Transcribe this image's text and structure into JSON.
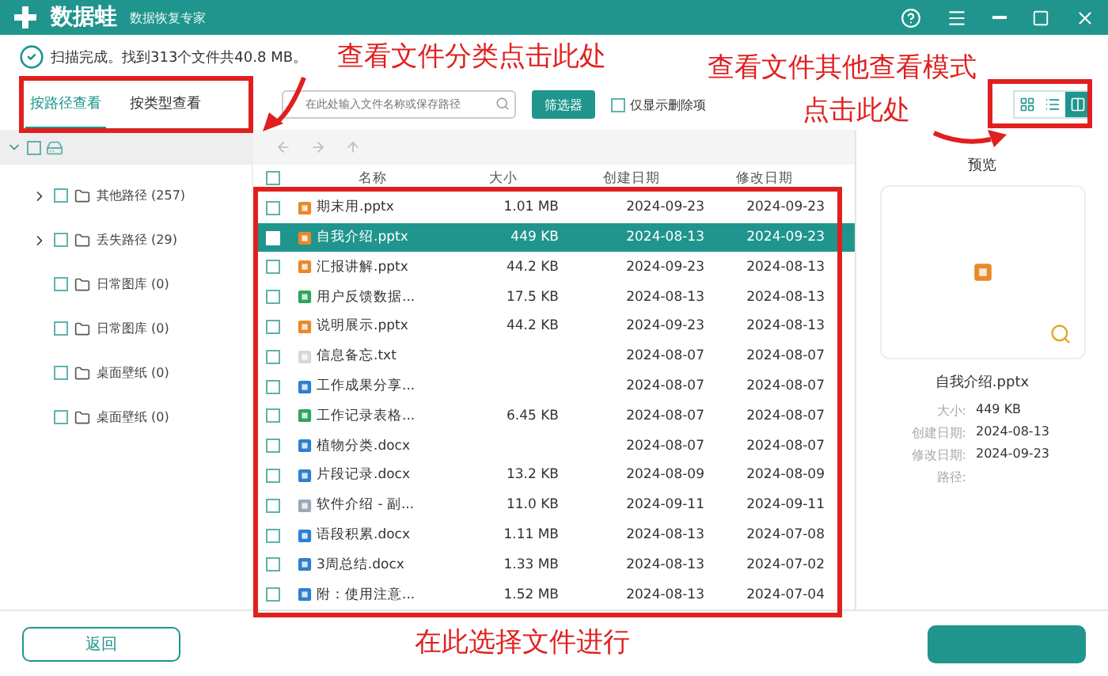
{
  "app": {
    "name": "数据蛙",
    "subtitle": "数据恢复专家"
  },
  "scan_status": "扫描完成。找到313个文件共40.8 MB。",
  "view_tabs": [
    {
      "label": "按路径查看",
      "selected": true
    },
    {
      "label": "按类型查看",
      "selected": false
    }
  ],
  "search": {
    "placeholder": "在此处输入文件名称或保存路径"
  },
  "filter_button": "筛选器",
  "deleted_only": {
    "label": "仅显示删除项",
    "checked": false
  },
  "view_modes": [
    {
      "kind": "grid",
      "selected": false
    },
    {
      "kind": "list",
      "selected": false
    },
    {
      "kind": "preview",
      "selected": true
    }
  ],
  "tree": {
    "expanded": true,
    "checked": false,
    "children": [
      {
        "label": "其他路径 (257)",
        "expandable": true,
        "checked": false
      },
      {
        "label": "丢失路径 (29)",
        "expandable": true,
        "checked": false
      },
      {
        "label": "日常图库 (0)",
        "expandable": false,
        "checked": false
      },
      {
        "label": "日常图库 (0)",
        "expandable": false,
        "checked": false
      },
      {
        "label": "桌面壁纸 (0)",
        "expandable": false,
        "checked": false
      },
      {
        "label": "桌面壁纸 (0)",
        "expandable": false,
        "checked": false
      }
    ]
  },
  "table": {
    "all_checked": false,
    "columns": [
      "名称",
      "大小",
      "创建日期",
      "修改日期"
    ],
    "rows": [
      {
        "kind": "ppt",
        "name": "期末用.pptx",
        "size": "1.01 MB",
        "created": "2024-09-23",
        "modified": "2024-09-23",
        "selected": false,
        "checked": false
      },
      {
        "kind": "ppt",
        "name": "自我介绍.pptx",
        "size": "449 KB",
        "created": "2024-08-13",
        "modified": "2024-09-23",
        "selected": true,
        "checked": false
      },
      {
        "kind": "ppt",
        "name": "汇报讲解.pptx",
        "size": "44.2 KB",
        "created": "2024-09-23",
        "modified": "2024-08-13",
        "selected": false,
        "checked": false
      },
      {
        "kind": "xls",
        "name": "用户反馈数据...",
        "size": "17.5 KB",
        "created": "2024-08-13",
        "modified": "2024-08-13",
        "selected": false,
        "checked": false
      },
      {
        "kind": "ppt",
        "name": "说明展示.pptx",
        "size": "44.2 KB",
        "created": "2024-09-23",
        "modified": "2024-08-13",
        "selected": false,
        "checked": false
      },
      {
        "kind": "txt",
        "name": "信息备忘.txt",
        "created": "2024-08-07",
        "modified": "2024-08-07",
        "selected": false,
        "checked": false
      },
      {
        "kind": "doc",
        "name": "工作成果分享...",
        "created": "2024-08-07",
        "modified": "2024-08-07",
        "selected": false,
        "checked": false
      },
      {
        "kind": "xls",
        "name": "工作记录表格...",
        "size": "6.45 KB",
        "created": "2024-08-07",
        "modified": "2024-08-07",
        "selected": false,
        "checked": false
      },
      {
        "kind": "doc",
        "name": "植物分类.docx",
        "created": "2024-08-07",
        "modified": "2024-08-07",
        "selected": false,
        "checked": false
      },
      {
        "kind": "doc",
        "name": "片段记录.docx",
        "size": "13.2 KB",
        "created": "2024-08-09",
        "modified": "2024-08-09",
        "selected": false,
        "checked": false
      },
      {
        "kind": "other",
        "name": "软件介绍 - 副...",
        "size": "11.0 KB",
        "created": "2024-09-11",
        "modified": "2024-09-11",
        "selected": false,
        "checked": false
      },
      {
        "kind": "doc",
        "name": "语段积累.docx",
        "size": "1.11 MB",
        "created": "2024-08-13",
        "modified": "2024-07-08",
        "selected": false,
        "checked": false
      },
      {
        "kind": "doc",
        "name": "3周总结.docx",
        "size": "1.33 MB",
        "created": "2024-08-13",
        "modified": "2024-07-02",
        "selected": false,
        "checked": false
      },
      {
        "kind": "doc",
        "name": "附：使用注意...",
        "size": "1.52 MB",
        "created": "2024-08-13",
        "modified": "2024-07-04",
        "selected": false,
        "checked": false
      }
    ]
  },
  "preview": {
    "title": "预览",
    "kind": "ppt",
    "file_name": "自我介绍.pptx",
    "details": [
      {
        "label": "大小:",
        "value": "449 KB"
      },
      {
        "label": "创建日期:",
        "value": "2024-08-13"
      },
      {
        "label": "修改日期:",
        "value": "2024-09-23"
      },
      {
        "label": "路径:"
      }
    ]
  },
  "back_button": "返回",
  "annotations": [
    "查看文件分类点击此处",
    "查看文件其他查看模式",
    "点击此处",
    "在此选择文件进行"
  ]
}
